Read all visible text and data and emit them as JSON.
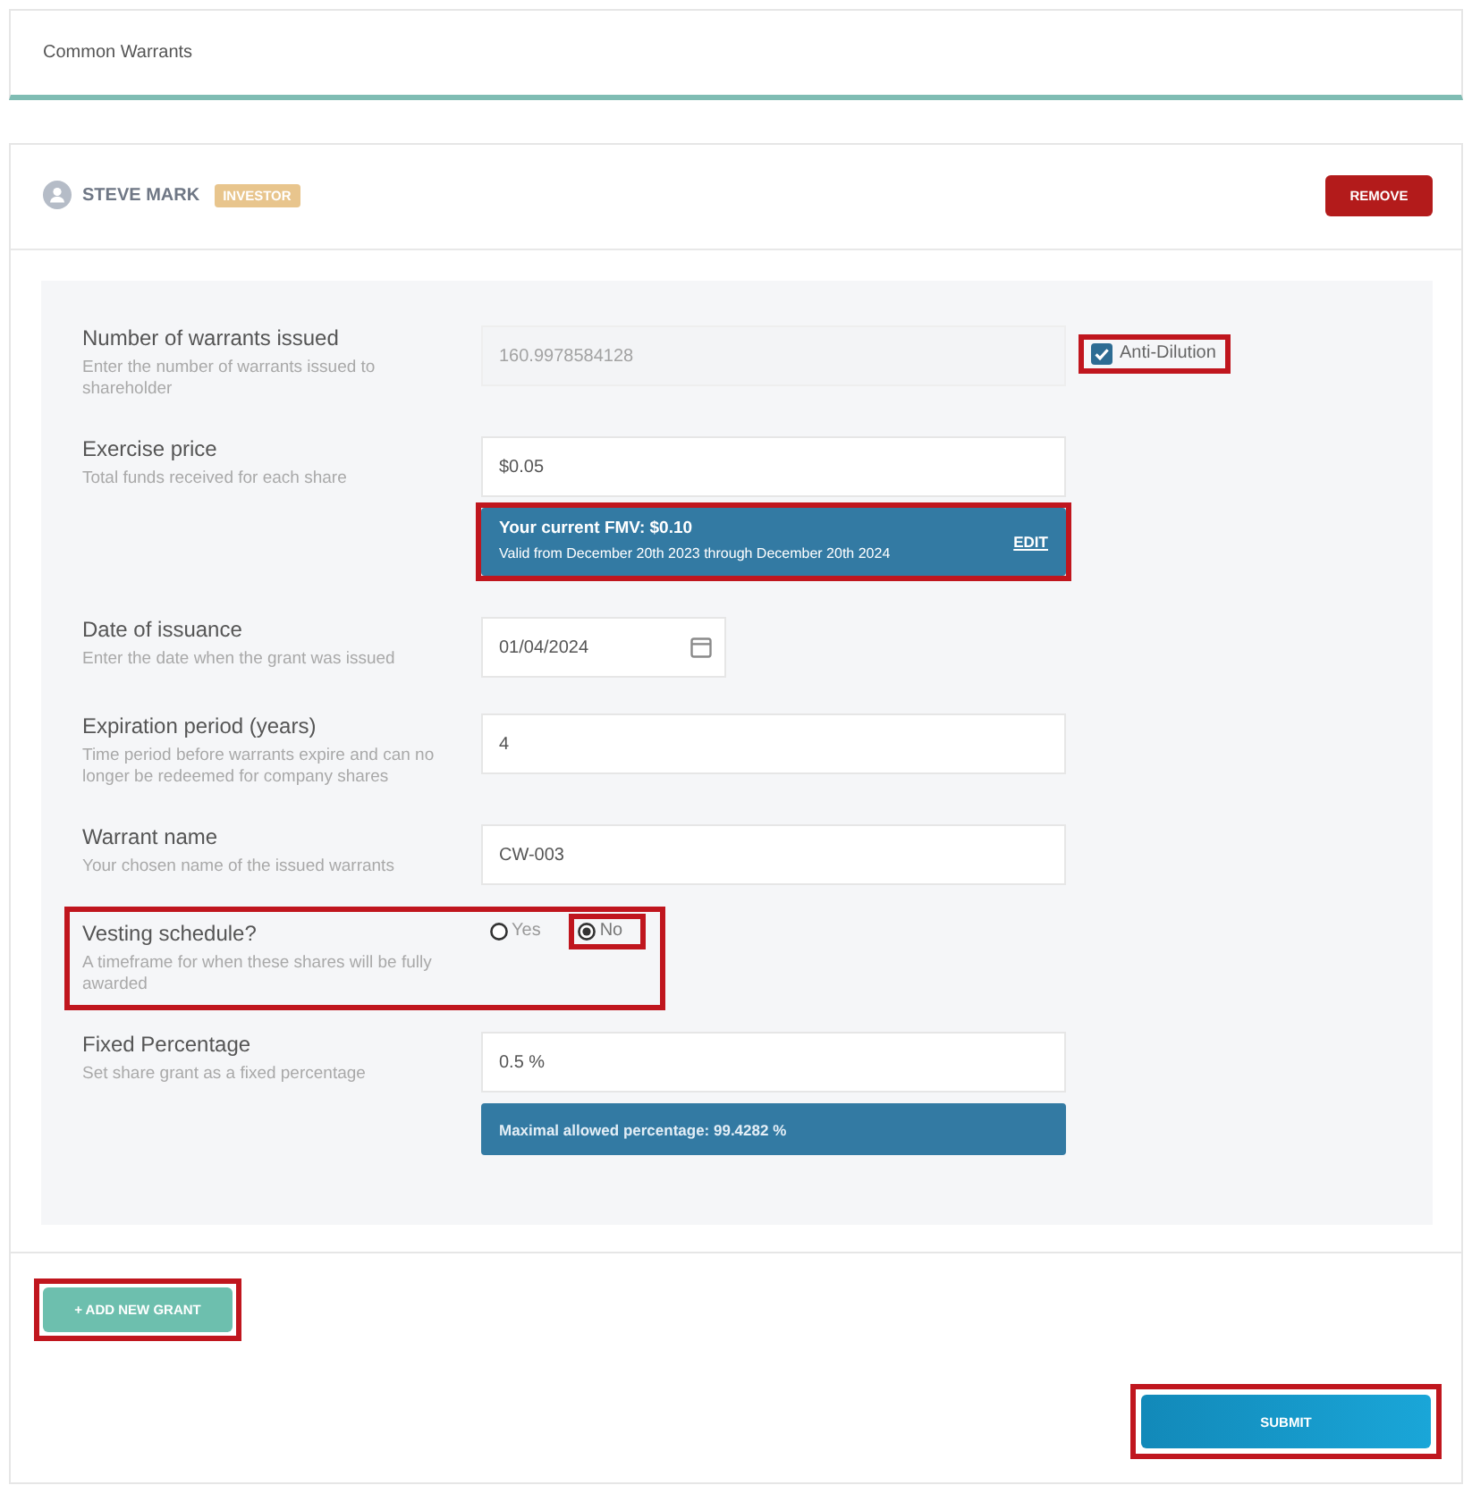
{
  "section": {
    "title": "Common Warrants"
  },
  "grant": {
    "holder": {
      "name": "STEVE MARK",
      "badge": "INVESTOR"
    },
    "remove_button": "REMOVE",
    "fields": [
      {
        "kind": "text",
        "label": "Number of warrants issued",
        "description": "Enter the number of warrants issued to shareholder",
        "value": "160.9978584128",
        "disabled": true,
        "highlighted": false,
        "option": {
          "label": "Anti-Dilution",
          "checked": true,
          "highlighted": true
        }
      },
      {
        "kind": "text",
        "label": "Exercise price",
        "description": "Total funds received for each share",
        "value": "$0.05",
        "disabled": false,
        "highlighted": false,
        "notice": {
          "title": "Your current FMV: $0.10",
          "text": "Valid from December 20th 2023 through December 20th 2024",
          "link": "EDIT",
          "highlighted": true
        }
      },
      {
        "kind": "date",
        "label": "Date of issuance",
        "description": "Enter the date when the grant was issued",
        "value": "01/04/2024",
        "disabled": false,
        "highlighted": false
      },
      {
        "kind": "text",
        "label": "Expiration period (years)",
        "description": "Time period before warrants expire and can no longer be redeemed for company shares",
        "value": "4",
        "disabled": false,
        "highlighted": false
      },
      {
        "kind": "text",
        "label": "Warrant name",
        "description": "Your chosen name of the issued warrants",
        "value": "CW-003",
        "disabled": false,
        "highlighted": false
      },
      {
        "kind": "radio",
        "label": "Vesting schedule?",
        "description": "A timeframe for when these shares will be fully awarded",
        "highlighted": true,
        "options": [
          {
            "label": "Yes",
            "selected": false,
            "highlighted": false
          },
          {
            "label": "No",
            "selected": true,
            "highlighted": true
          }
        ]
      },
      {
        "kind": "text",
        "label": "Fixed Percentage",
        "description": "Set share grant as a fixed percentage",
        "value": "0.5 %",
        "disabled": false,
        "highlighted": false,
        "notice": {
          "text": "Maximal allowed percentage: 99.4282 %",
          "highlighted": false
        }
      }
    ]
  },
  "add_button": {
    "label": "+ ADD NEW GRANT",
    "highlighted": true
  },
  "submit_button": {
    "label": "SUBMIT",
    "highlighted": true
  }
}
